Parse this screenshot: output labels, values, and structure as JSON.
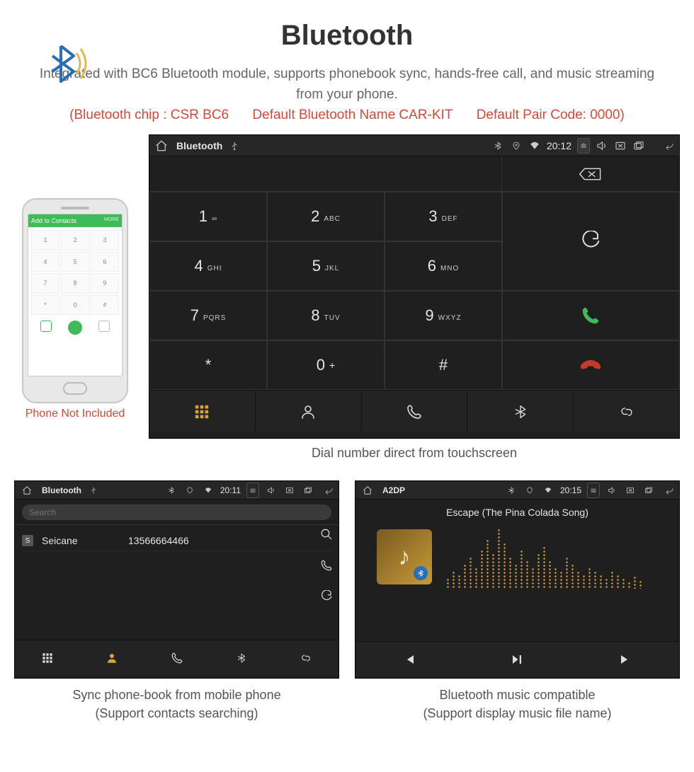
{
  "header": {
    "title": "Bluetooth",
    "subtitle": "Integrated with BC6 Bluetooth module, supports phonebook sync, hands-free call, and music streaming from your phone.",
    "spec_chip": "(Bluetooth chip : CSR BC6",
    "spec_name": "Default Bluetooth Name CAR-KIT",
    "spec_pin": "Default Pair Code: 0000)"
  },
  "phone": {
    "caption": "Phone Not Included",
    "mini_header": "Add to Contacts",
    "mini_more": "MORE",
    "mini_keys": [
      "1",
      "2",
      "3",
      "4",
      "5",
      "6",
      "7",
      "8",
      "9",
      "*",
      "0",
      "#"
    ]
  },
  "dialer": {
    "status_title": "Bluetooth",
    "time": "20:12",
    "keys": [
      {
        "n": "1",
        "s": "∞"
      },
      {
        "n": "2",
        "s": "ABC"
      },
      {
        "n": "3",
        "s": "DEF"
      },
      {
        "n": "4",
        "s": "GHI"
      },
      {
        "n": "5",
        "s": "JKL"
      },
      {
        "n": "6",
        "s": "MNO"
      },
      {
        "n": "7",
        "s": "PQRS"
      },
      {
        "n": "8",
        "s": "TUV"
      },
      {
        "n": "9",
        "s": "WXYZ"
      },
      {
        "n": "*",
        "s": ""
      },
      {
        "n": "0",
        "s": "+"
      },
      {
        "n": "#",
        "s": ""
      }
    ],
    "caption": "Dial number direct from touchscreen"
  },
  "phonebook": {
    "status_title": "Bluetooth",
    "time": "20:11",
    "search_placeholder": "Search",
    "contact_badge": "S",
    "contact_name": "Seicane",
    "contact_number": "13566664466",
    "caption_l1": "Sync phone-book from mobile phone",
    "caption_l2": "(Support contacts searching)"
  },
  "a2dp": {
    "status_title": "A2DP",
    "time": "20:15",
    "track": "Escape (The Pina Colada Song)",
    "caption_l1": "Bluetooth music compatible",
    "caption_l2": "(Support display music file name)"
  }
}
